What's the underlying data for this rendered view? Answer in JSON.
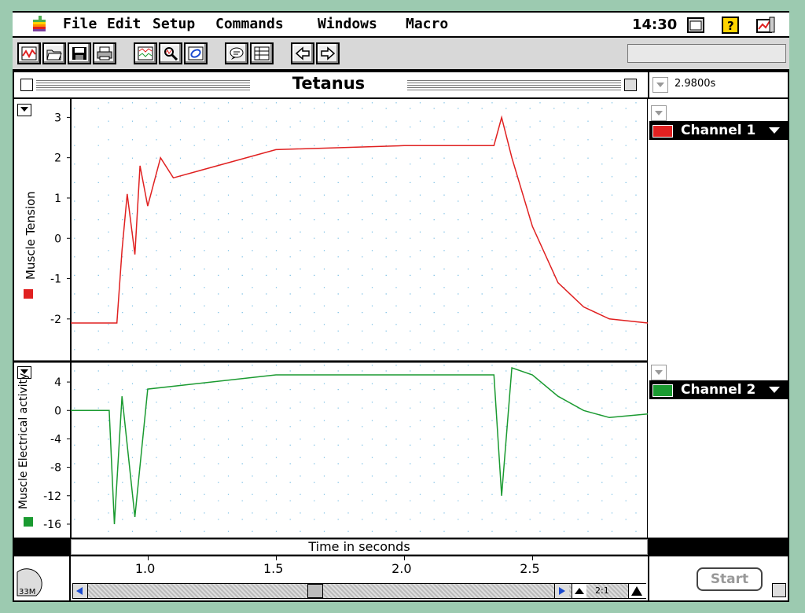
{
  "menubar": {
    "items": [
      "File",
      "Edit",
      "Setup",
      "Commands",
      "Windows",
      "Macro"
    ],
    "clock": "14:30"
  },
  "window": {
    "title": "Tetanus",
    "time_readout": "2.9800s",
    "channels": [
      {
        "name": "Channel 1",
        "ylabel": "Muscle Tension",
        "color": "#e02020"
      },
      {
        "name": "Channel 2",
        "ylabel": "Muscle Electrical activity",
        "color": "#1a9a30"
      }
    ],
    "xlabel": "Time in seconds",
    "zoom": "2:1",
    "start_label": "Start",
    "scale_label": "33M"
  },
  "chart_data": [
    {
      "type": "line",
      "ylabel": "Muscle Tension",
      "series": [
        {
          "name": "Channel 1",
          "color": "#e02020"
        }
      ],
      "x_range": [
        0.7,
        2.95
      ],
      "ylim": [
        -2.9,
        3.3
      ],
      "yticks": [
        3,
        2,
        1,
        0,
        -1,
        -2
      ],
      "x": [
        0.7,
        0.8,
        0.88,
        0.9,
        0.92,
        0.95,
        0.97,
        1.0,
        1.05,
        1.1,
        1.5,
        2.0,
        2.35,
        2.38,
        2.42,
        2.5,
        2.6,
        2.7,
        2.8,
        2.95
      ],
      "y": [
        -2.1,
        -2.1,
        -2.1,
        -0.3,
        1.1,
        -0.4,
        1.8,
        0.8,
        2.0,
        1.5,
        2.2,
        2.3,
        2.3,
        3.0,
        2.0,
        0.3,
        -1.1,
        -1.7,
        -2.0,
        -2.1
      ]
    },
    {
      "type": "line",
      "ylabel": "Muscle Electrical activity",
      "series": [
        {
          "name": "Channel 2",
          "color": "#1a9a30"
        }
      ],
      "x_range": [
        0.7,
        2.95
      ],
      "ylim": [
        -17,
        6
      ],
      "yticks": [
        4,
        0,
        -4,
        -8,
        -12,
        -16
      ],
      "x": [
        0.7,
        0.85,
        0.87,
        0.9,
        0.95,
        1.0,
        1.5,
        2.0,
        2.35,
        2.38,
        2.42,
        2.5,
        2.6,
        2.7,
        2.8,
        2.95
      ],
      "y": [
        0,
        0,
        -16,
        2,
        -15,
        3,
        5,
        5,
        5,
        -12,
        6,
        5,
        2,
        0,
        -1,
        -0.5
      ]
    }
  ],
  "xaxis": {
    "ticks": [
      "1.0",
      "1.5",
      "2.0",
      "2.5"
    ],
    "values": [
      1.0,
      1.5,
      2.0,
      2.5
    ]
  }
}
